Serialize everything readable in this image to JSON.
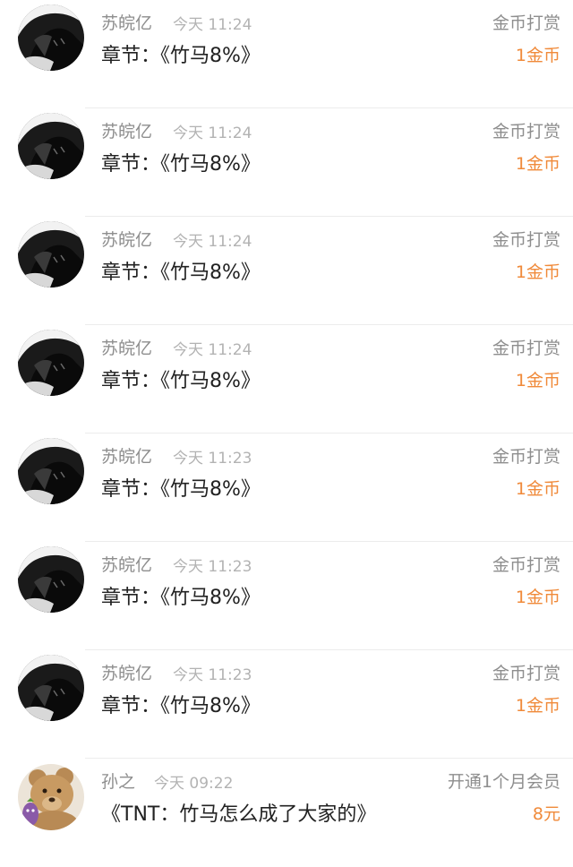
{
  "colors": {
    "muted_text": "#8e8e8e",
    "time_text": "#b3b3b3",
    "primary_text": "#222222",
    "amount_orange": "#f08a3a",
    "separator": "#ececec"
  },
  "records": [
    {
      "avatar_icon": "dark-anime-avatar-icon",
      "user": "苏皖亿",
      "time": "今天 11:24",
      "type": "金币打赏",
      "content": "章节：《竹马8%》",
      "amount": "1金币"
    },
    {
      "avatar_icon": "dark-anime-avatar-icon",
      "user": "苏皖亿",
      "time": "今天 11:24",
      "type": "金币打赏",
      "content": "章节：《竹马8%》",
      "amount": "1金币"
    },
    {
      "avatar_icon": "dark-anime-avatar-icon",
      "user": "苏皖亿",
      "time": "今天 11:24",
      "type": "金币打赏",
      "content": "章节：《竹马8%》",
      "amount": "1金币"
    },
    {
      "avatar_icon": "dark-anime-avatar-icon",
      "user": "苏皖亿",
      "time": "今天 11:24",
      "type": "金币打赏",
      "content": "章节：《竹马8%》",
      "amount": "1金币"
    },
    {
      "avatar_icon": "dark-anime-avatar-icon",
      "user": "苏皖亿",
      "time": "今天 11:23",
      "type": "金币打赏",
      "content": "章节：《竹马8%》",
      "amount": "1金币"
    },
    {
      "avatar_icon": "dark-anime-avatar-icon",
      "user": "苏皖亿",
      "time": "今天 11:23",
      "type": "金币打赏",
      "content": "章节：《竹马8%》",
      "amount": "1金币"
    },
    {
      "avatar_icon": "dark-anime-avatar-icon",
      "user": "苏皖亿",
      "time": "今天 11:23",
      "type": "金币打赏",
      "content": "章节：《竹马8%》",
      "amount": "1金币"
    },
    {
      "avatar_icon": "teddy-bear-avatar-icon",
      "user": "孙之",
      "time": "今天 09:22",
      "type": "开通1个月会员",
      "content": "《TNT：竹马怎么成了大家的》",
      "amount": "8元"
    }
  ]
}
